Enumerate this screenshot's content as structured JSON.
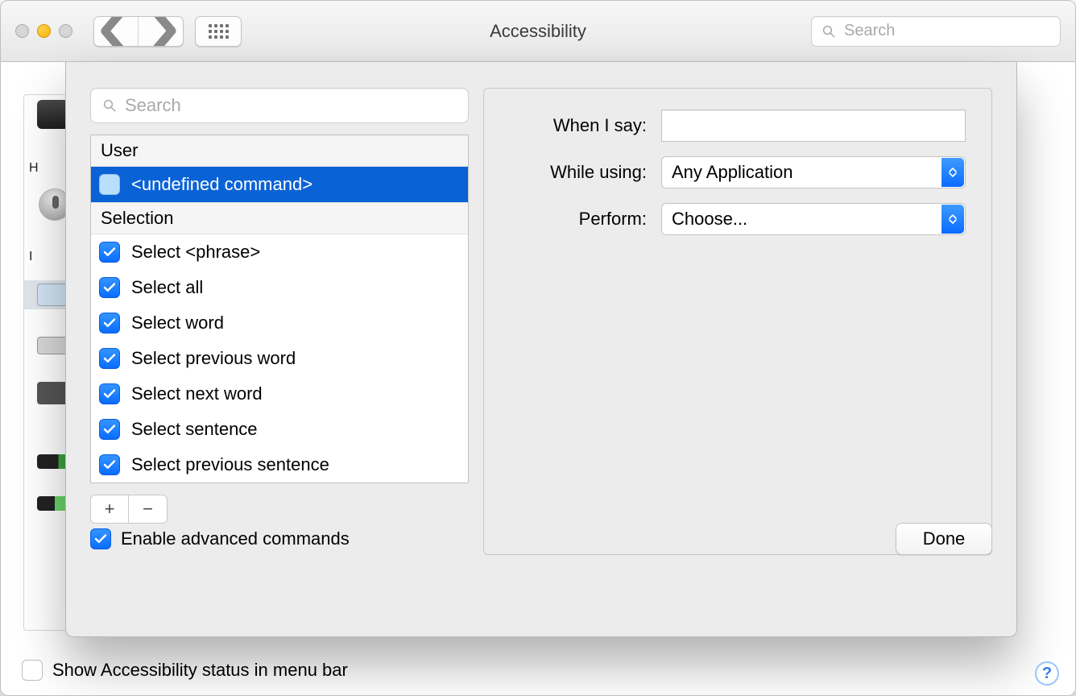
{
  "window": {
    "title": "Accessibility",
    "search_placeholder": "Search"
  },
  "sidebar": {
    "labels": {
      "hearing": "H",
      "interacting": "I"
    }
  },
  "sheet": {
    "search_placeholder": "Search",
    "sections": [
      {
        "title": "User",
        "items": [
          {
            "label": "<undefined command>",
            "checked": false,
            "selected": true
          }
        ]
      },
      {
        "title": "Selection",
        "items": [
          {
            "label": "Select <phrase>",
            "checked": true,
            "selected": false
          },
          {
            "label": "Select all",
            "checked": true,
            "selected": false
          },
          {
            "label": "Select word",
            "checked": true,
            "selected": false
          },
          {
            "label": "Select previous word",
            "checked": true,
            "selected": false
          },
          {
            "label": "Select next word",
            "checked": true,
            "selected": false
          },
          {
            "label": "Select sentence",
            "checked": true,
            "selected": false
          },
          {
            "label": "Select previous sentence",
            "checked": true,
            "selected": false
          }
        ]
      }
    ],
    "buttons": {
      "add": "+",
      "remove": "−"
    },
    "form": {
      "when_i_say_label": "When I say:",
      "when_i_say_value": "",
      "while_using_label": "While using:",
      "while_using_value": "Any Application",
      "perform_label": "Perform:",
      "perform_value": "Choose..."
    },
    "enable_advanced_label": "Enable advanced commands",
    "enable_advanced_checked": true,
    "done": "Done"
  },
  "footer": {
    "show_status_label": "Show Accessibility status in menu bar",
    "show_status_checked": false,
    "help": "?"
  }
}
